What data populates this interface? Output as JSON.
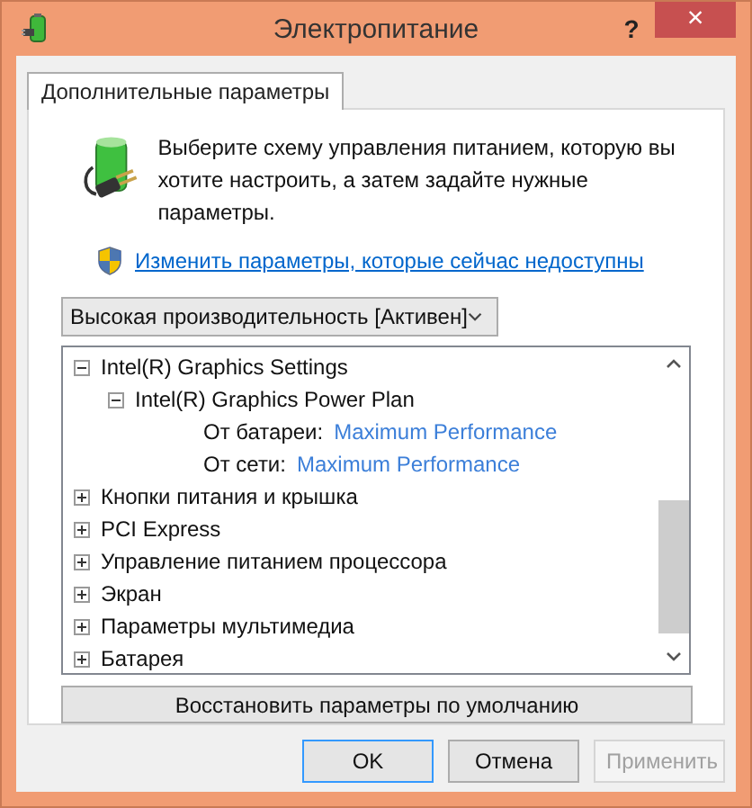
{
  "window": {
    "title": "Электропитание",
    "help": "?",
    "close": "×"
  },
  "tabs": [
    {
      "label": "Дополнительные параметры",
      "selected": true
    }
  ],
  "description": "Выберите схему управления питанием, которую вы хотите настроить, а затем задайте нужные параметры.",
  "link": "Изменить параметры, которые сейчас недоступны",
  "plan_dropdown": {
    "value": "Высокая производительность [Активен]"
  },
  "tree": [
    {
      "kind": "group",
      "label": "Intel(R) Graphics Settings",
      "expanded": true,
      "children": [
        {
          "kind": "group",
          "label": "Intel(R) Graphics Power Plan",
          "expanded": true,
          "children": [
            {
              "kind": "setting",
              "label": "От батареи:",
              "value": "Maximum Performance"
            },
            {
              "kind": "setting",
              "label": "От сети:",
              "value": "Maximum Performance"
            }
          ]
        }
      ]
    },
    {
      "kind": "group",
      "label": "Кнопки питания и крышка",
      "expanded": false
    },
    {
      "kind": "group",
      "label": "PCI Express",
      "expanded": false
    },
    {
      "kind": "group",
      "label": "Управление питанием процессора",
      "expanded": false
    },
    {
      "kind": "group",
      "label": "Экран",
      "expanded": false
    },
    {
      "kind": "group",
      "label": "Параметры мультимедиа",
      "expanded": false
    },
    {
      "kind": "group",
      "label": "Батарея",
      "expanded": false
    }
  ],
  "restore_button": "Восстановить параметры по умолчанию",
  "buttons": [
    {
      "label": "OK",
      "disabled": false,
      "default": true
    },
    {
      "label": "Отмена",
      "disabled": false,
      "default": false
    },
    {
      "label": "Применить",
      "disabled": true,
      "default": false
    }
  ]
}
